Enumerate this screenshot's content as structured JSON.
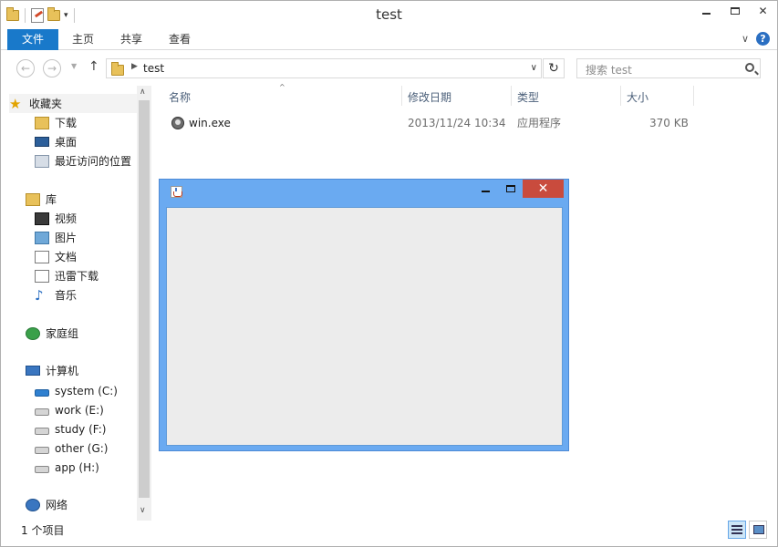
{
  "window": {
    "title": "test"
  },
  "ribbon": {
    "tabs": [
      "文件",
      "主页",
      "共享",
      "查看"
    ]
  },
  "address": {
    "crumb": "test"
  },
  "search": {
    "placeholder": "搜索 test"
  },
  "nav": {
    "favorites": {
      "label": "收藏夹",
      "items": [
        "下载",
        "桌面",
        "最近访问的位置"
      ]
    },
    "libraries": {
      "label": "库",
      "items": [
        "视频",
        "图片",
        "文档",
        "迅雷下载",
        "音乐"
      ]
    },
    "homegroup": "家庭组",
    "computer": {
      "label": "计算机",
      "drives": [
        "system (C:)",
        "work (E:)",
        "study (F:)",
        "other (G:)",
        "app (H:)"
      ]
    },
    "network": "网络"
  },
  "columns": {
    "name": "名称",
    "modified": "修改日期",
    "type": "类型",
    "size": "大小"
  },
  "files": [
    {
      "name": "win.exe",
      "modified": "2013/11/24 10:34",
      "type": "应用程序",
      "size": "370 KB"
    }
  ],
  "status": {
    "count": "1 个项目"
  },
  "colors": {
    "accent": "#1979ca",
    "java_frame": "#6aaaf1",
    "close_red": "#c94b3d"
  }
}
